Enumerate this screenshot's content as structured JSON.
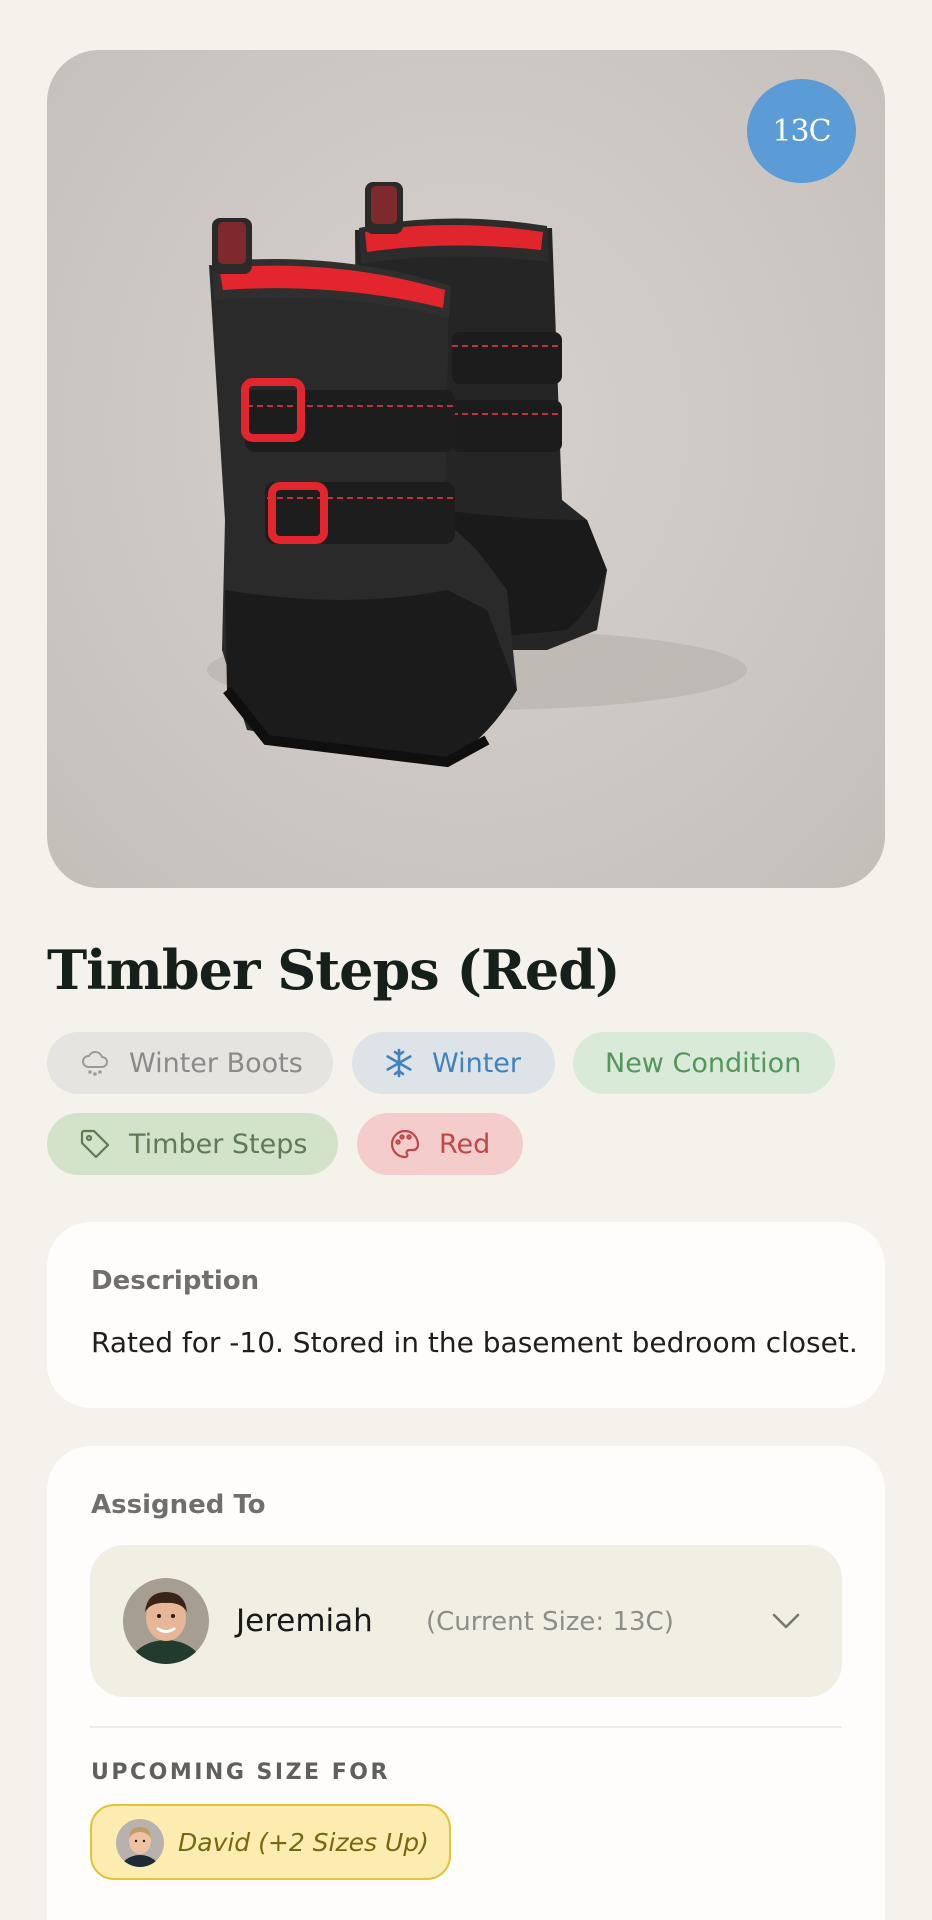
{
  "product": {
    "size_badge": "13C",
    "title": "Timber Steps (Red)",
    "tags": [
      {
        "label": "Winter Boots",
        "icon": "snow-cloud-icon"
      },
      {
        "label": "Winter",
        "icon": "snowflake-icon"
      },
      {
        "label": "New Condition",
        "icon": ""
      },
      {
        "label": "Timber Steps",
        "icon": "tag-icon"
      },
      {
        "label": "Red",
        "icon": "palette-icon"
      }
    ]
  },
  "description": {
    "label": "Description",
    "text": "Rated for -10. Stored in the basement bedroom closet."
  },
  "assignment": {
    "label": "Assigned To",
    "name": "Jeremiah",
    "current_size": "(Current Size: 13C)",
    "upcoming_label": "UPCOMING SIZE FOR",
    "upcoming_name": "David (+2 Sizes Up)"
  },
  "colors": {
    "background": "#f5f2ec",
    "size_badge": "#5b9bd6",
    "upcoming_chip": "#fcecb0"
  }
}
